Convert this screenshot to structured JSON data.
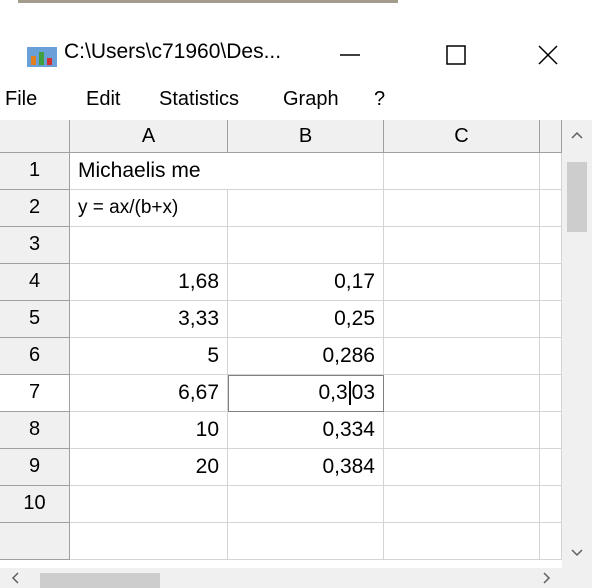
{
  "window": {
    "title": "C:\\Users\\c71960\\Des..."
  },
  "menu": [
    "File",
    "Edit",
    "Statistics",
    "Graph",
    "?"
  ],
  "columns": [
    "A",
    "B",
    "C"
  ],
  "rows": [
    {
      "num": "1",
      "a": "Michaelis me",
      "b": ""
    },
    {
      "num": "2",
      "a": "y = ax/(b+x)",
      "b": ""
    },
    {
      "num": "3",
      "a": "",
      "b": ""
    },
    {
      "num": "4",
      "a": "1,68",
      "b": "0,17"
    },
    {
      "num": "5",
      "a": "3,33",
      "b": "0,25"
    },
    {
      "num": "6",
      "a": "5",
      "b": "0,286"
    },
    {
      "num": "7",
      "a": "6,67",
      "b_before": "0,3",
      "b_after": "03"
    },
    {
      "num": "8",
      "a": "10",
      "b": "0,334"
    },
    {
      "num": "9",
      "a": "20",
      "b": "0,384"
    },
    {
      "num": "10",
      "a": "",
      "b": ""
    }
  ],
  "colors": {
    "header_bg": "#f0f0f0",
    "grid_line": "#d4d4d4",
    "scrollbar": "#f0f0f0"
  }
}
